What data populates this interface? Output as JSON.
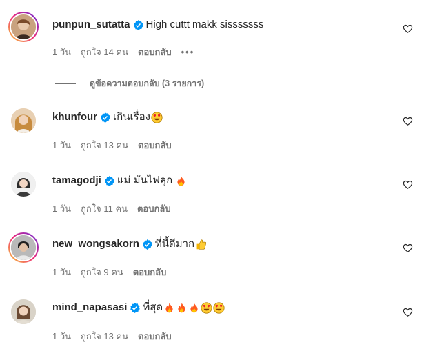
{
  "comments": [
    {
      "username": "punpun_sutatta",
      "text": "High cuttt makk sisssssss",
      "time": "1 วัน",
      "likes": "ถูกใจ 14 คน",
      "reply": "ตอบกลับ",
      "more": "•••",
      "has_story_ring": true,
      "view_replies": "ดูข้อความตอบกลับ (3 รายการ)"
    },
    {
      "username": "khunfour",
      "text": "เกินเรื่อง",
      "emojis": [
        "heart-eyes-emoji"
      ],
      "time": "1 วัน",
      "likes": "ถูกใจ 13 คน",
      "reply": "ตอบกลับ",
      "has_story_ring": false
    },
    {
      "username": "tamagodji",
      "text": "แม่ มันไฟลุก",
      "emojis": [
        "fire-emoji"
      ],
      "time": "1 วัน",
      "likes": "ถูกใจ 11 คน",
      "reply": "ตอบกลับ",
      "has_story_ring": false
    },
    {
      "username": "new_wongsakorn",
      "text": "ที่นี้ดีมาก",
      "emojis": [
        "thumbs-up-emoji"
      ],
      "time": "1 วัน",
      "likes": "ถูกใจ 9 คน",
      "reply": "ตอบกลับ",
      "has_story_ring": true
    },
    {
      "username": "mind_napasasi",
      "text": "ที่สุด",
      "emojis": [
        "fire-emoji",
        "fire-emoji",
        "fire-emoji",
        "heart-eyes-emoji",
        "heart-eyes-emoji"
      ],
      "time": "1 วัน",
      "likes": "ถูกใจ 13 คน",
      "reply": "ตอบกลับ",
      "has_story_ring": false
    }
  ],
  "colors": {
    "verified": "#0095f6",
    "meta_text": "#737373",
    "text": "#262626"
  },
  "icons": {
    "verified": "verified-badge-icon",
    "like": "heart-outline-icon"
  }
}
